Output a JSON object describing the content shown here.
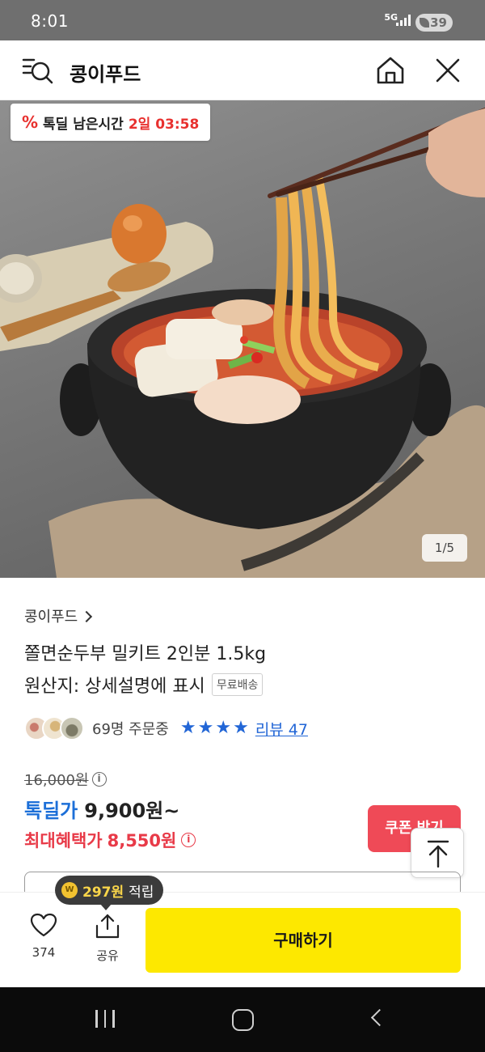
{
  "status_bar": {
    "time": "8:01",
    "network": "5G",
    "battery": "39"
  },
  "header": {
    "title": "콩이푸드",
    "icons": [
      "menu-search-icon",
      "home-icon",
      "close-icon"
    ]
  },
  "hero": {
    "deal_badge": {
      "icon_text": "%",
      "label": "톡딜 남은시간",
      "remaining": "2일 03:58"
    },
    "image_counter": "1/5"
  },
  "product": {
    "brand": "콩이푸드",
    "name": "쫄면순두부 밀키트 2인분 1.5kg",
    "origin": "원산지: 상세설명에 표시",
    "shipping_badge": "무료배송",
    "buyers": "69명 주문중",
    "rating_stars": 4,
    "review_link": "리뷰 47"
  },
  "pricing": {
    "original_price": "16,000원",
    "deal_label": "톡딜가",
    "deal_price": "9,900원~",
    "max_benefit_label": "최대혜택가",
    "max_benefit_price": "8,550원",
    "info_glyph": "i",
    "coupon_button": "쿠폰 받기"
  },
  "bottom_bar": {
    "points_coin": "W",
    "points_amount": "297원",
    "points_suffix": "적립",
    "like_count": "374",
    "share_label": "공유",
    "buy_button": "구매하기"
  },
  "colors": {
    "deal_blue": "#1c6fd8",
    "benefit_red": "#e83a48",
    "buy_yellow": "#fde800",
    "coupon_red": "#ef4a57",
    "countdown_red": "#e8312f"
  }
}
